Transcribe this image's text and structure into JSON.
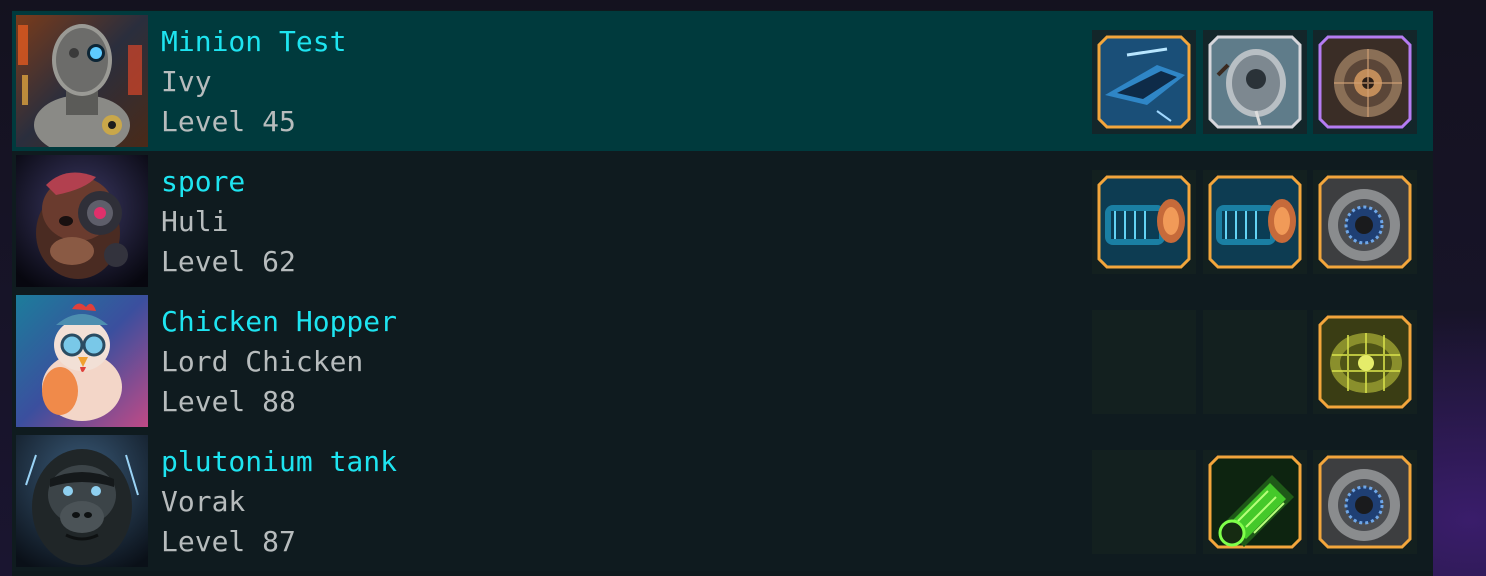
{
  "colors": {
    "name": "#1ee4f0",
    "secondary_text": "#b7bcbd",
    "row_background": "#0f1b1f",
    "selected_row_background": "#003a3d",
    "legendary_border": "#f3a63c",
    "epic_border": "#b57cf2",
    "rare_border": "#d7d7dc"
  },
  "minions": [
    {
      "name": "Minion Test",
      "pilot": "Ivy",
      "level": "Level 45",
      "selected": true,
      "portrait": "robot-portrait",
      "items": [
        {
          "icon": "spaceship-icon",
          "rarity": "legendary"
        },
        {
          "icon": "capsule-icon",
          "rarity": "rare"
        },
        {
          "icon": "engine-icon",
          "rarity": "epic"
        }
      ]
    },
    {
      "name": "spore",
      "pilot": "Huli",
      "level": "Level 62",
      "selected": false,
      "portrait": "cyber-ape-portrait",
      "items": [
        {
          "icon": "blaster-icon",
          "rarity": "legendary"
        },
        {
          "icon": "blaster-icon",
          "rarity": "legendary"
        },
        {
          "icon": "turbine-icon",
          "rarity": "legendary"
        }
      ]
    },
    {
      "name": "Chicken Hopper",
      "pilot": "Lord Chicken",
      "level": "Level 88",
      "selected": false,
      "portrait": "chicken-portrait",
      "items": [
        null,
        null,
        {
          "icon": "circuit-engine-icon",
          "rarity": "legendary"
        }
      ]
    },
    {
      "name": "plutonium tank",
      "pilot": "Vorak",
      "level": "Level 87",
      "selected": false,
      "portrait": "gorilla-portrait",
      "items": [
        null,
        {
          "icon": "plutonium-canister-icon",
          "rarity": "legendary"
        },
        {
          "icon": "turbine-icon",
          "rarity": "legendary"
        }
      ]
    }
  ]
}
